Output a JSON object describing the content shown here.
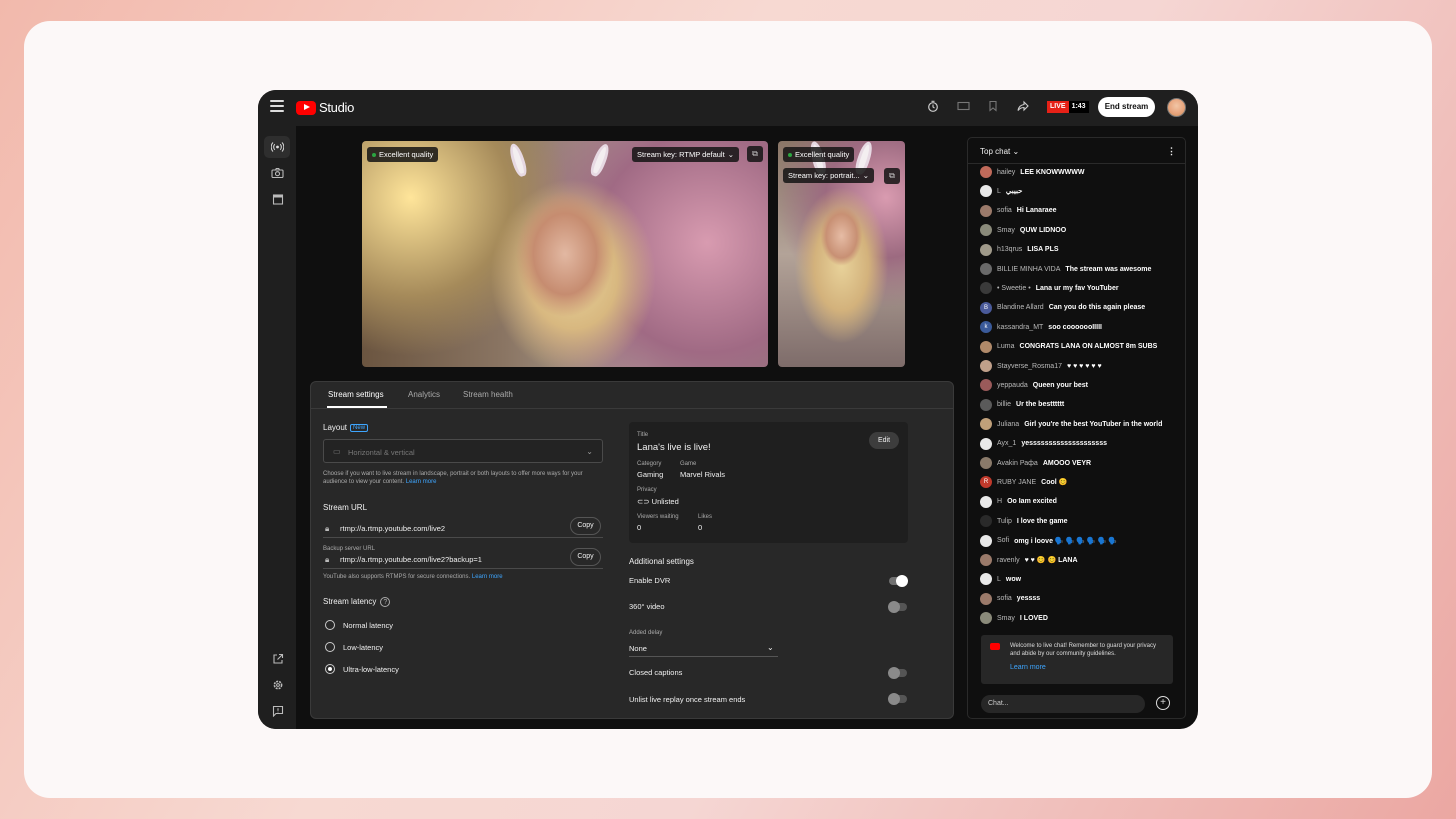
{
  "app": {
    "logo_text": "Studio",
    "live_label": "LIVE",
    "live_time": "1:43",
    "end_stream": "End stream"
  },
  "preview": {
    "main_quality": "Excellent quality",
    "main_stream_key": "Stream key: RTMP default",
    "side_quality": "Excellent quality",
    "side_stream_key": "Stream key: portrait..."
  },
  "tabs": [
    "Stream settings",
    "Analytics",
    "Stream health"
  ],
  "settings": {
    "layout_label": "Layout",
    "new_badge": "New",
    "layout_value": "Horizontal & vertical",
    "layout_help": "Choose if you want to live stream in landscape, portrait or both layouts to offer more ways for your audience to view your content.",
    "learn_more": "Learn more",
    "stream_url_label": "Stream URL",
    "stream_url": "rtmp://a.rtmp.youtube.com/live2",
    "copy": "Copy",
    "backup_label": "Backup server URL",
    "backup_url": "rtmp://a.rtmp.youtube.com/live2?backup=1",
    "rtmps_note": "YouTube also supports RTMPS for secure connections.",
    "latency_label": "Stream latency",
    "latency_options": [
      "Normal latency",
      "Low-latency",
      "Ultra-low-latency"
    ],
    "latency_selected": "Ultra-low-latency"
  },
  "info": {
    "title_label": "Title",
    "title": "Lana's live is live!",
    "edit": "Edit",
    "category_label": "Category",
    "category": "Gaming",
    "game_label": "Game",
    "game": "Marvel Rivals",
    "privacy_label": "Privacy",
    "privacy": "Unlisted",
    "viewers_label": "Viewers waiting",
    "viewers": "0",
    "likes_label": "Likes",
    "likes": "0"
  },
  "additional": {
    "heading": "Additional settings",
    "enable_dvr": "Enable DVR",
    "enable_dvr_on": true,
    "video_360": "360° video",
    "video_360_on": false,
    "added_delay_label": "Added delay",
    "added_delay": "None",
    "closed_captions": "Closed captions",
    "closed_captions_on": false,
    "unlist_replay": "Unlist live replay once stream ends",
    "unlist_replay_on": false
  },
  "chat": {
    "mode": "Top chat",
    "messages": [
      {
        "author": "hailey",
        "text": "LEE KNOWWWWW",
        "avatar_color": "#c06a5a",
        "initial": ""
      },
      {
        "author": "L",
        "text": "حبيبي",
        "avatar_color": "#e9e9e9",
        "initial": ""
      },
      {
        "author": "sofia",
        "text": "Hi Lanaraee",
        "avatar_color": "#9b7a6a",
        "initial": ""
      },
      {
        "author": "Smay",
        "text": "QUW LIDNOO",
        "avatar_color": "#8a8a7a",
        "initial": ""
      },
      {
        "author": "h13qrus",
        "text": "LISA PLS",
        "avatar_color": "#a09a8a",
        "initial": ""
      },
      {
        "author": "BILLIE MINHA VIDA",
        "text": "The stream was awesome",
        "avatar_color": "#6a6a6a",
        "initial": ""
      },
      {
        "author": "• Sweetie •",
        "text": "Lana ur my fav YouTuber",
        "avatar_color": "#3a3a3a",
        "initial": ""
      },
      {
        "author": "Blandine Allard",
        "text": "Can you do this again please",
        "avatar_color": "#4a5a9a",
        "initial": "B"
      },
      {
        "author": "kassandra_MT",
        "text": "soo cooooooIIIII",
        "avatar_color": "#3a5a9a",
        "initial": "k"
      },
      {
        "author": "Luma",
        "text": "CONGRATS LANA ON ALMOST 8m SUBS",
        "avatar_color": "#b08a6a",
        "initial": ""
      },
      {
        "author": "Stayverse_Rosma17",
        "text": "♥ ♥ ♥ ♥ ♥ ♥",
        "avatar_color": "#c0a08a",
        "initial": ""
      },
      {
        "author": "yeppauda",
        "text": "Queen your best",
        "avatar_color": "#9a5a5a",
        "initial": ""
      },
      {
        "author": "billie",
        "text": "Ur the bestttttt",
        "avatar_color": "#5a5a5a",
        "initial": ""
      },
      {
        "author": "Juliana",
        "text": "Girl you're the best YouTuber in the world",
        "avatar_color": "#c0a07a",
        "initial": ""
      },
      {
        "author": "Ayx_1",
        "text": "yessssssssssssssssssss",
        "avatar_color": "#e9e9e9",
        "initial": ""
      },
      {
        "author": "Avakin Рафа",
        "text": "AMOOO VEYR",
        "avatar_color": "#8a7a6a",
        "initial": ""
      },
      {
        "author": "RUBY JANE",
        "text": "Cool 😊",
        "avatar_color": "#c0392b",
        "initial": "R"
      },
      {
        "author": "H",
        "text": "Oo Iam excited",
        "avatar_color": "#e9e9e9",
        "initial": ""
      },
      {
        "author": "Tulip",
        "text": "I love the game",
        "avatar_color": "#2a2a2a",
        "initial": ""
      },
      {
        "author": "Sofi",
        "text": "omg i loove 🗣️ 🗣️ 🗣️ 🗣️ 🗣️ 🗣️",
        "avatar_color": "#e9e9e9",
        "initial": ""
      },
      {
        "author": "ravenly",
        "text": "♥ ♥ 😊 😊 LANA",
        "avatar_color": "#9a7a6a",
        "initial": ""
      },
      {
        "author": "L",
        "text": "wow",
        "avatar_color": "#e9e9e9",
        "initial": ""
      },
      {
        "author": "sofia",
        "text": "yessss",
        "avatar_color": "#9b7a6a",
        "initial": ""
      },
      {
        "author": "Smay",
        "text": "I LOVED",
        "avatar_color": "#8a8a7a",
        "initial": ""
      }
    ],
    "welcome_text": "Welcome to live chat! Remember to guard your privacy and abide by our community guidelines.",
    "welcome_link": "Learn more",
    "input_placeholder": "Chat..."
  }
}
